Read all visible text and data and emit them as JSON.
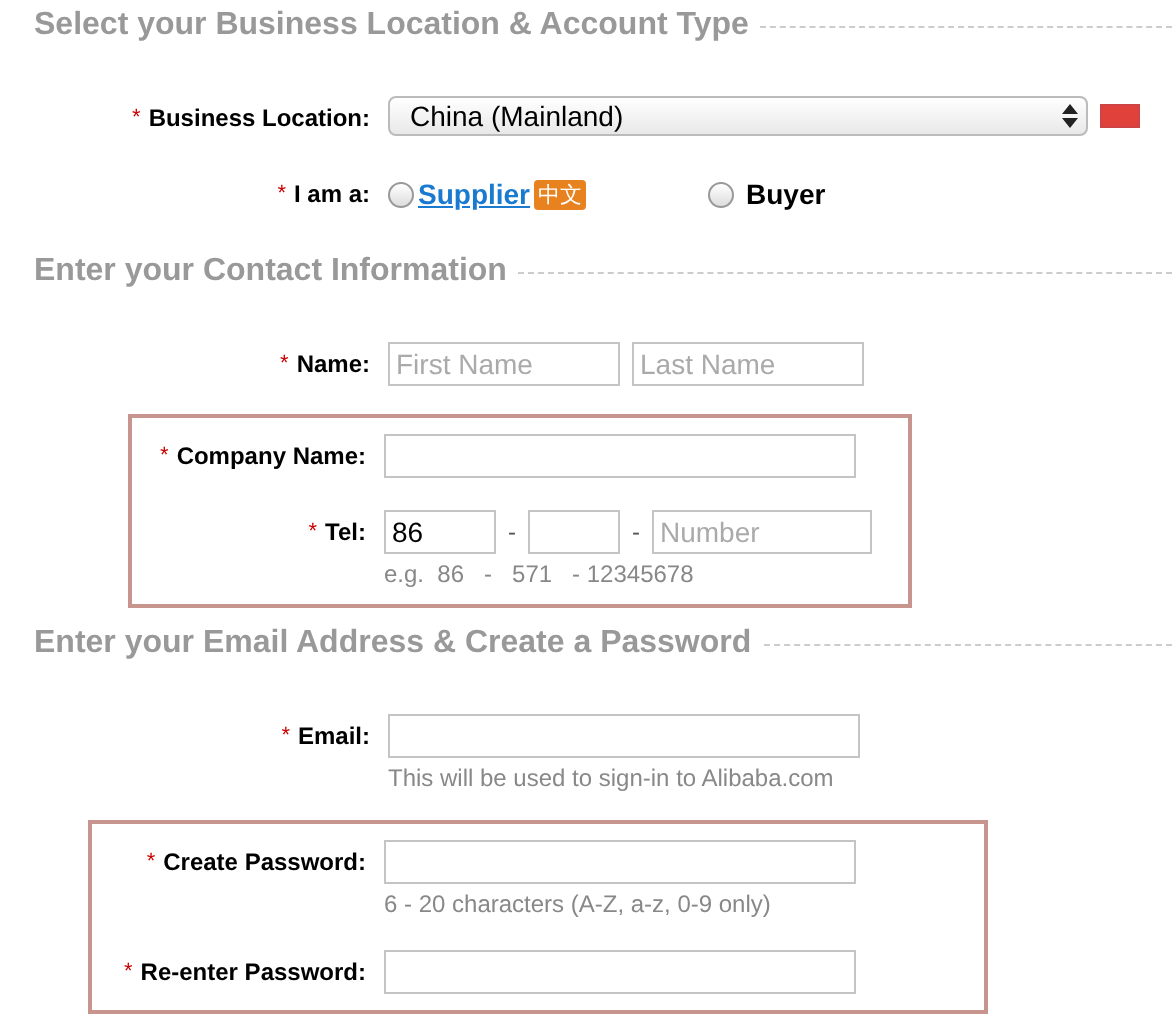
{
  "sections": [
    {
      "title": "Select your Business Location & Account Type",
      "groups": [
        {
          "highlighted": false,
          "rows": [
            {
              "kind": "select",
              "mark": "*",
              "label": "Business Location:",
              "value": "China (Mainland)"
            },
            {
              "kind": "radio",
              "mark": "*",
              "label": "I am a:",
              "options": [
                {
                  "label": "Supplier",
                  "selected": false,
                  "link": true,
                  "badge": "中文"
                },
                {
                  "label": "Buyer",
                  "selected": false,
                  "link": false
                }
              ]
            }
          ]
        }
      ]
    },
    {
      "title": "Enter your Contact Information",
      "groups": [
        {
          "highlighted": false,
          "rows": [
            {
              "kind": "name",
              "mark": "*",
              "label": "Name:",
              "fields": [
                {
                  "placeholder": "First Name"
                },
                {
                  "placeholder": "Last Name"
                }
              ]
            }
          ]
        },
        {
          "highlighted": true,
          "rows": [
            {
              "kind": "text",
              "mark": "*",
              "label": "Company Name:"
            },
            {
              "kind": "tel",
              "mark": "*",
              "label": "Tel:",
              "parts": [
                {
                  "kind": "country",
                  "value": "86"
                },
                {
                  "kind": "area"
                },
                {
                  "kind": "number",
                  "placeholder": "Number"
                }
              ],
              "separator": "-",
              "hint": "e.g.  86   -   571   - 12345678"
            }
          ]
        }
      ]
    },
    {
      "title": "Enter your Email Address & Create a Password",
      "groups": [
        {
          "highlighted": false,
          "rows": [
            {
              "kind": "text",
              "mark": "*",
              "label": "Email:",
              "hint": "This will be used to sign-in to Alibaba.com"
            }
          ]
        },
        {
          "highlighted": true,
          "rows": [
            {
              "kind": "text",
              "mark": "*",
              "label": "Create Password:",
              "hint": "6 - 20 characters (A-Z, a-z, 0-9 only)"
            },
            {
              "kind": "text",
              "mark": "*",
              "label": "Re-enter Password:"
            }
          ]
        }
      ]
    }
  ]
}
